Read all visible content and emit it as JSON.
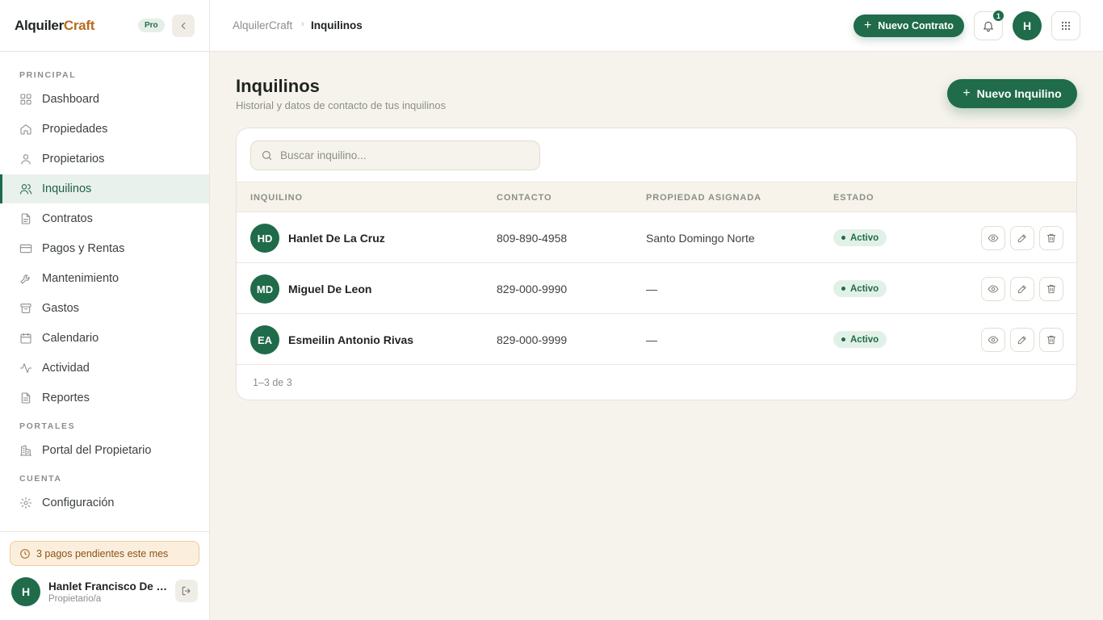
{
  "brand": {
    "name_part1": "Alquiler",
    "name_part2": "Craft",
    "plan_badge": "Pro"
  },
  "sidebar": {
    "sections": [
      {
        "title": "PRINCIPAL"
      },
      {
        "title": "PORTALES"
      },
      {
        "title": "CUENTA"
      }
    ],
    "items": [
      {
        "label": "Dashboard",
        "icon": "grid-icon"
      },
      {
        "label": "Propiedades",
        "icon": "home-icon"
      },
      {
        "label": "Propietarios",
        "icon": "user-icon"
      },
      {
        "label": "Inquilinos",
        "icon": "users-icon",
        "active": true
      },
      {
        "label": "Contratos",
        "icon": "file-icon"
      },
      {
        "label": "Pagos y Rentas",
        "icon": "credit-card-icon"
      },
      {
        "label": "Mantenimiento",
        "icon": "wrench-icon"
      },
      {
        "label": "Gastos",
        "icon": "archive-icon"
      },
      {
        "label": "Calendario",
        "icon": "calendar-icon"
      },
      {
        "label": "Actividad",
        "icon": "activity-icon"
      },
      {
        "label": "Reportes",
        "icon": "report-icon"
      },
      {
        "label": "Portal del Propietario",
        "icon": "building-icon"
      },
      {
        "label": "Configuración",
        "icon": "gear-icon"
      }
    ],
    "footer": {
      "pending_notice": "3 pagos pendientes este mes",
      "user_initial": "H",
      "user_name": "Hanlet Francisco De L...",
      "user_role": "Propietario/a"
    }
  },
  "topbar": {
    "breadcrumb": [
      "AlquilerCraft",
      "Inquilinos"
    ],
    "breadcrumb_separator": "›",
    "new_contract_label": "Nuevo Contrato",
    "notification_count": "1",
    "avatar_initial": "H"
  },
  "main": {
    "title": "Inquilinos",
    "subtitle": "Historial y datos de contacto de tus inquilinos",
    "new_tenant_label": "Nuevo Inquilino",
    "search_placeholder": "Buscar inquilino...",
    "columns": [
      "INQUILINO",
      "CONTACTO",
      "PROPIEDAD ASIGNADA",
      "ESTADO"
    ],
    "rows": [
      {
        "initials": "HD",
        "name": "Hanlet De La Cruz",
        "contact": "809-890-4958",
        "property": "Santo Domingo Norte",
        "status": "Activo"
      },
      {
        "initials": "MD",
        "name": "Miguel De Leon",
        "contact": "829-000-9990",
        "property": "—",
        "status": "Activo"
      },
      {
        "initials": "EA",
        "name": "Esmeilin Antonio Rivas",
        "contact": "829-000-9999",
        "property": "—",
        "status": "Activo"
      }
    ],
    "pagination": "1–3 de 3"
  },
  "colors": {
    "accent": "#1f6b4a",
    "brand_highlight": "#b86a1f",
    "background": "#f6f3ec",
    "pending_bg": "#fbeedd"
  }
}
